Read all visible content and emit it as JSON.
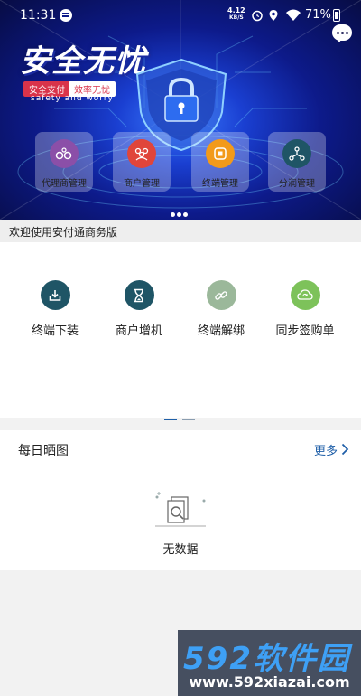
{
  "status_bar": {
    "time": "11:31",
    "net_speed_value": "4.12",
    "net_speed_unit": "KB/S",
    "battery": "71%"
  },
  "banner": {
    "title": "安全无忧",
    "tag1": "安全支付",
    "tag2": "效率无忧",
    "subtitle": "safety and worry",
    "cards": [
      {
        "label": "代理商管理",
        "icon": "agent-icon",
        "color": "#8b4fa8"
      },
      {
        "label": "商户管理",
        "icon": "merchant-icon",
        "color": "#e0453a"
      },
      {
        "label": "终端管理",
        "icon": "terminal-icon",
        "color": "#f29a1a"
      },
      {
        "label": "分润管理",
        "icon": "share-icon",
        "color": "#1f5566"
      }
    ]
  },
  "welcome": {
    "text": "欢迎使用安付通商务版"
  },
  "grid": {
    "items": [
      {
        "label": "终端下装",
        "icon": "download-icon",
        "color": "#1f5566"
      },
      {
        "label": "商户增机",
        "icon": "hourglass-icon",
        "color": "#1f5566"
      },
      {
        "label": "终端解绑",
        "icon": "unlink-icon",
        "color": "#9bb89a"
      },
      {
        "label": "同步签购单",
        "icon": "sync-icon",
        "color": "#7dc25a"
      }
    ],
    "pager_active": "#1f5fa8",
    "pager_inactive": "#8a9db0"
  },
  "daily": {
    "title": "每日晒图",
    "more": "更多",
    "empty_text": "无数据"
  },
  "watermark": {
    "brand": "592软件园",
    "url": "www.592xiazai.com"
  }
}
